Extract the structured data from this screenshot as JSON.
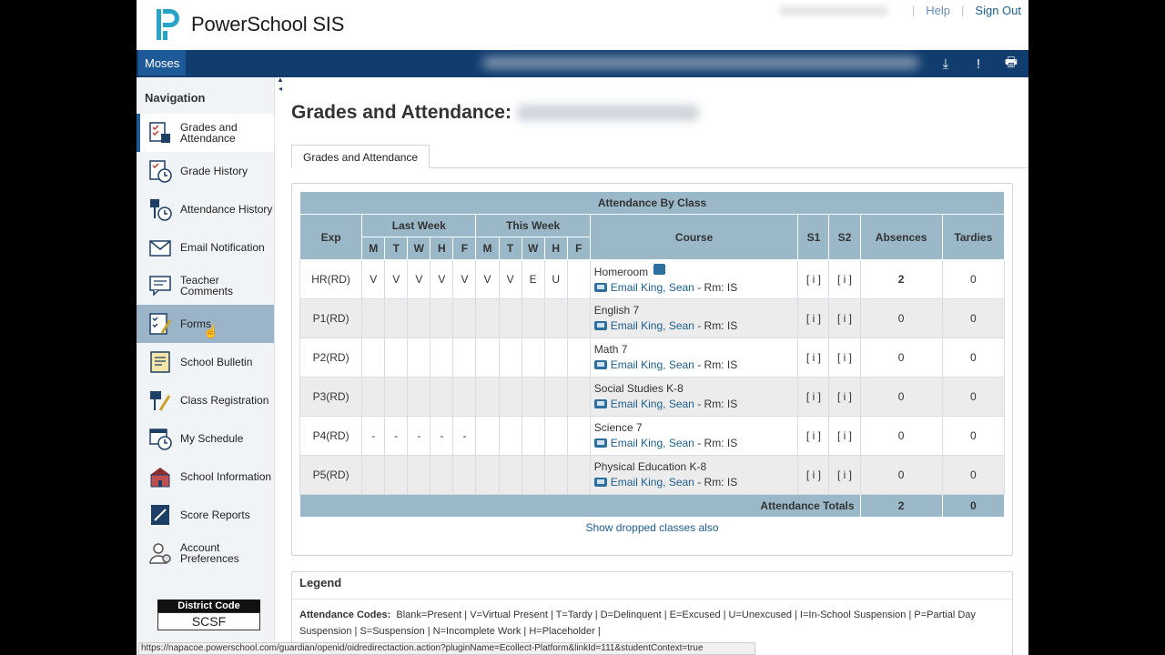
{
  "app": {
    "logo_text": "PowerSchool SIS"
  },
  "header": {
    "help": "Help",
    "sign_out": "Sign Out",
    "student": "Moses"
  },
  "sidebar": {
    "title": "Navigation",
    "items": [
      {
        "label": "Grades and Attendance",
        "icon": "grades-icon"
      },
      {
        "label": "Grade History",
        "icon": "grade-history-icon"
      },
      {
        "label": "Attendance History",
        "icon": "attendance-history-icon"
      },
      {
        "label": "Email Notification",
        "icon": "email-icon"
      },
      {
        "label": "Teacher Comments",
        "icon": "comments-icon"
      },
      {
        "label": "Forms",
        "icon": "forms-icon"
      },
      {
        "label": "School Bulletin",
        "icon": "bulletin-icon"
      },
      {
        "label": "Class Registration",
        "icon": "registration-icon"
      },
      {
        "label": "My Schedule",
        "icon": "schedule-icon"
      },
      {
        "label": "School Information",
        "icon": "school-icon"
      },
      {
        "label": "Score Reports",
        "icon": "score-reports-icon"
      },
      {
        "label": "Account Preferences",
        "icon": "account-icon"
      }
    ],
    "district_title": "District Code",
    "district_code": "SCSF"
  },
  "main": {
    "title": "Grades and Attendance:",
    "tab": "Grades and Attendance",
    "table_caption": "Attendance By Class",
    "headers": {
      "exp": "Exp",
      "last_week": "Last Week",
      "this_week": "This Week",
      "course": "Course",
      "s1": "S1",
      "s2": "S2",
      "absences": "Absences",
      "tardies": "Tardies",
      "days": [
        "M",
        "T",
        "W",
        "H",
        "F",
        "M",
        "T",
        "W",
        "H",
        "F"
      ]
    },
    "rows": [
      {
        "exp": "HR(RD)",
        "days": [
          "V",
          "V",
          "V",
          "V",
          "V",
          "V",
          "V",
          "E",
          "U",
          ""
        ],
        "course": "Homeroom",
        "teacher": "Email King, Sean",
        "room": " - Rm: IS",
        "s1": "[ i ]",
        "s2": "[ i ]",
        "absences": "2",
        "tardies": "0"
      },
      {
        "exp": "P1(RD)",
        "days": [
          "",
          "",
          "",
          "",
          "",
          "",
          "",
          "",
          "",
          ""
        ],
        "course": "English 7",
        "teacher": "Email King, Sean",
        "room": " - Rm: IS",
        "s1": "[ i ]",
        "s2": "[ i ]",
        "absences": "0",
        "tardies": "0"
      },
      {
        "exp": "P2(RD)",
        "days": [
          "",
          "",
          "",
          "",
          "",
          "",
          "",
          "",
          "",
          ""
        ],
        "course": "Math 7",
        "teacher": "Email King, Sean",
        "room": " - Rm: IS",
        "s1": "[ i ]",
        "s2": "[ i ]",
        "absences": "0",
        "tardies": "0"
      },
      {
        "exp": "P3(RD)",
        "days": [
          "",
          "",
          "",
          "",
          "",
          "",
          "",
          "",
          "",
          ""
        ],
        "course": "Social Studies K-8",
        "teacher": "Email King, Sean",
        "room": " - Rm: IS",
        "s1": "[ i ]",
        "s2": "[ i ]",
        "absences": "0",
        "tardies": "0"
      },
      {
        "exp": "P4(RD)",
        "days": [
          "-",
          "-",
          "-",
          "-",
          "-",
          "",
          "",
          "",
          "",
          ""
        ],
        "course": "Science 7",
        "teacher": "Email King, Sean",
        "room": " - Rm: IS",
        "s1": "[ i ]",
        "s2": "[ i ]",
        "absences": "0",
        "tardies": "0"
      },
      {
        "exp": "P5(RD)",
        "days": [
          "",
          "",
          "",
          "",
          "",
          "",
          "",
          "",
          "",
          ""
        ],
        "course": "Physical Education K-8",
        "teacher": "Email King, Sean",
        "room": " - Rm: IS",
        "s1": "[ i ]",
        "s2": "[ i ]",
        "absences": "0",
        "tardies": "0"
      }
    ],
    "totals": {
      "label": "Attendance Totals",
      "absences": "2",
      "tardies": "0"
    },
    "dropped_link": "Show dropped classes also"
  },
  "legend": {
    "title": "Legend",
    "attendance_label": "Attendance Codes:",
    "attendance_text": "Blank=Present | V=Virtual Present | T=Tardy | D=Delinquent | E=Excused | U=Unexcused | I=In-School Suspension | P=Partial Day Suspension | S=Suspension | N=Incomplete Work | H=Placeholder |"
  },
  "status_url": "https://napacoe.powerschool.com/guardian/openid/oidredirectaction.action?pluginName=Ecollect-Platform&linkId=111&studentContext=true"
}
